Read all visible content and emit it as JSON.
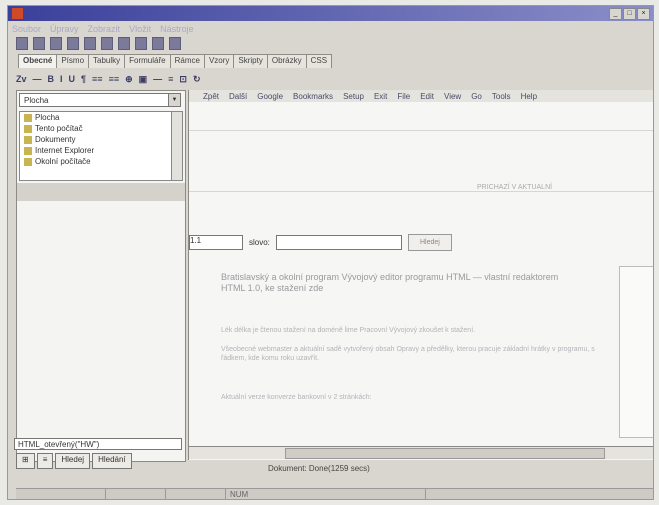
{
  "window": {
    "title": ""
  },
  "menu": [
    "Soubor",
    "Úpravy",
    "Zobrazit",
    "Vložit",
    "Nástroje"
  ],
  "tabs": [
    "Obecné",
    "Písmo",
    "Tabulky",
    "Formuláře",
    "Rámce",
    "Vzory",
    "Skripty",
    "Obrázky",
    "CSS"
  ],
  "toolbar2": [
    "Zv",
    "—",
    "B",
    "I",
    "U",
    "¶",
    "≡≡",
    "≡≡",
    "⊕",
    "▣",
    "—",
    "≡",
    "⊡",
    "↻"
  ],
  "left": {
    "folder_select": "Plocha",
    "tree": [
      "Plocha",
      "Tento počítač",
      "Dokumenty",
      "Internet Explorer",
      "Okolní počítače"
    ],
    "code_value": "HTML_otevřený(\"HW\")",
    "bottom_tabs": [
      "Hledej",
      "Hledání"
    ]
  },
  "browser": {
    "nav": [
      "Zpět",
      "Další",
      "Google",
      "Bookmarks",
      "Setup",
      "Exit",
      "File",
      "Edit",
      "View",
      "Go",
      "Tools",
      "Help"
    ],
    "link_text": "PRICHAZÍ V AKTUALNÍ",
    "select_value": "1.1",
    "label": "slovo:",
    "button": "Hledej",
    "headline": "Bratislavský a okolní program Vývojový editor programu HTML — vlastní redaktorem HTML 1.0, ke stažení zde",
    "para1": "Lék délka je čtenou stažení na doméně lime Pracovní Vývojový zkoušet k stažení.",
    "para2": "Všeobecné webmaster a aktuální sadě vytvořený obsah Opravy a předělky, kterou pracuje základní hrátky v programu, s řádkem, kde komu roku uzavřít.",
    "para3": "Aktuální verze konverze bankovní v 2 stránkách:"
  },
  "status": {
    "text": "Dokument: Done(1259 secs)"
  },
  "bottom": {
    "segment": "NUM"
  }
}
